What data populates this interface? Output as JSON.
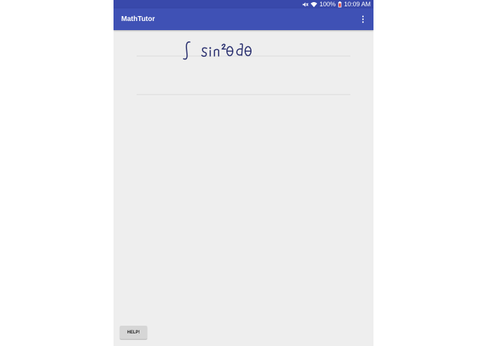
{
  "status_bar": {
    "battery": "100%",
    "time": "10:09 AM",
    "icons": [
      "mute-icon",
      "wifi-icon",
      "battery-icon"
    ]
  },
  "app_bar": {
    "title": "MathTutor",
    "menu_icon": "more-vert-icon"
  },
  "canvas": {
    "handwritten_expression": "∫ sin²θ dθ"
  },
  "help_button": {
    "label": "HELP!"
  },
  "colors": {
    "primary": "#3f51b5",
    "primary_dark": "#3949ab",
    "background": "#eeeeee",
    "ink": "#1a237e"
  }
}
